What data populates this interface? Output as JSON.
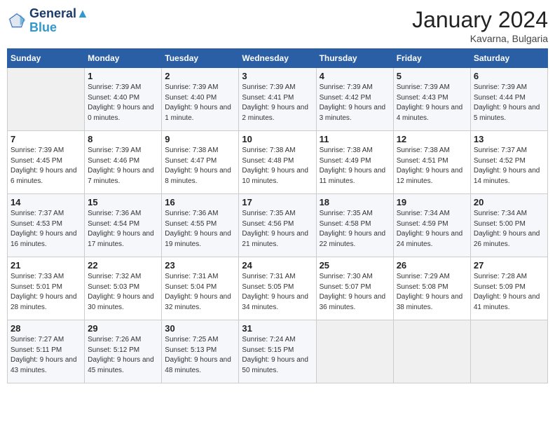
{
  "header": {
    "logo_line1": "General",
    "logo_line2": "Blue",
    "month": "January 2024",
    "location": "Kavarna, Bulgaria"
  },
  "weekdays": [
    "Sunday",
    "Monday",
    "Tuesday",
    "Wednesday",
    "Thursday",
    "Friday",
    "Saturday"
  ],
  "weeks": [
    [
      {
        "day": "",
        "sunrise": "",
        "sunset": "",
        "daylight": "",
        "empty": true
      },
      {
        "day": "1",
        "sunrise": "Sunrise: 7:39 AM",
        "sunset": "Sunset: 4:40 PM",
        "daylight": "Daylight: 9 hours and 0 minutes."
      },
      {
        "day": "2",
        "sunrise": "Sunrise: 7:39 AM",
        "sunset": "Sunset: 4:40 PM",
        "daylight": "Daylight: 9 hours and 1 minute."
      },
      {
        "day": "3",
        "sunrise": "Sunrise: 7:39 AM",
        "sunset": "Sunset: 4:41 PM",
        "daylight": "Daylight: 9 hours and 2 minutes."
      },
      {
        "day": "4",
        "sunrise": "Sunrise: 7:39 AM",
        "sunset": "Sunset: 4:42 PM",
        "daylight": "Daylight: 9 hours and 3 minutes."
      },
      {
        "day": "5",
        "sunrise": "Sunrise: 7:39 AM",
        "sunset": "Sunset: 4:43 PM",
        "daylight": "Daylight: 9 hours and 4 minutes."
      },
      {
        "day": "6",
        "sunrise": "Sunrise: 7:39 AM",
        "sunset": "Sunset: 4:44 PM",
        "daylight": "Daylight: 9 hours and 5 minutes."
      }
    ],
    [
      {
        "day": "7",
        "sunrise": "Sunrise: 7:39 AM",
        "sunset": "Sunset: 4:45 PM",
        "daylight": "Daylight: 9 hours and 6 minutes."
      },
      {
        "day": "8",
        "sunrise": "Sunrise: 7:39 AM",
        "sunset": "Sunset: 4:46 PM",
        "daylight": "Daylight: 9 hours and 7 minutes."
      },
      {
        "day": "9",
        "sunrise": "Sunrise: 7:38 AM",
        "sunset": "Sunset: 4:47 PM",
        "daylight": "Daylight: 9 hours and 8 minutes."
      },
      {
        "day": "10",
        "sunrise": "Sunrise: 7:38 AM",
        "sunset": "Sunset: 4:48 PM",
        "daylight": "Daylight: 9 hours and 10 minutes."
      },
      {
        "day": "11",
        "sunrise": "Sunrise: 7:38 AM",
        "sunset": "Sunset: 4:49 PM",
        "daylight": "Daylight: 9 hours and 11 minutes."
      },
      {
        "day": "12",
        "sunrise": "Sunrise: 7:38 AM",
        "sunset": "Sunset: 4:51 PM",
        "daylight": "Daylight: 9 hours and 12 minutes."
      },
      {
        "day": "13",
        "sunrise": "Sunrise: 7:37 AM",
        "sunset": "Sunset: 4:52 PM",
        "daylight": "Daylight: 9 hours and 14 minutes."
      }
    ],
    [
      {
        "day": "14",
        "sunrise": "Sunrise: 7:37 AM",
        "sunset": "Sunset: 4:53 PM",
        "daylight": "Daylight: 9 hours and 16 minutes."
      },
      {
        "day": "15",
        "sunrise": "Sunrise: 7:36 AM",
        "sunset": "Sunset: 4:54 PM",
        "daylight": "Daylight: 9 hours and 17 minutes."
      },
      {
        "day": "16",
        "sunrise": "Sunrise: 7:36 AM",
        "sunset": "Sunset: 4:55 PM",
        "daylight": "Daylight: 9 hours and 19 minutes."
      },
      {
        "day": "17",
        "sunrise": "Sunrise: 7:35 AM",
        "sunset": "Sunset: 4:56 PM",
        "daylight": "Daylight: 9 hours and 21 minutes."
      },
      {
        "day": "18",
        "sunrise": "Sunrise: 7:35 AM",
        "sunset": "Sunset: 4:58 PM",
        "daylight": "Daylight: 9 hours and 22 minutes."
      },
      {
        "day": "19",
        "sunrise": "Sunrise: 7:34 AM",
        "sunset": "Sunset: 4:59 PM",
        "daylight": "Daylight: 9 hours and 24 minutes."
      },
      {
        "day": "20",
        "sunrise": "Sunrise: 7:34 AM",
        "sunset": "Sunset: 5:00 PM",
        "daylight": "Daylight: 9 hours and 26 minutes."
      }
    ],
    [
      {
        "day": "21",
        "sunrise": "Sunrise: 7:33 AM",
        "sunset": "Sunset: 5:01 PM",
        "daylight": "Daylight: 9 hours and 28 minutes."
      },
      {
        "day": "22",
        "sunrise": "Sunrise: 7:32 AM",
        "sunset": "Sunset: 5:03 PM",
        "daylight": "Daylight: 9 hours and 30 minutes."
      },
      {
        "day": "23",
        "sunrise": "Sunrise: 7:31 AM",
        "sunset": "Sunset: 5:04 PM",
        "daylight": "Daylight: 9 hours and 32 minutes."
      },
      {
        "day": "24",
        "sunrise": "Sunrise: 7:31 AM",
        "sunset": "Sunset: 5:05 PM",
        "daylight": "Daylight: 9 hours and 34 minutes."
      },
      {
        "day": "25",
        "sunrise": "Sunrise: 7:30 AM",
        "sunset": "Sunset: 5:07 PM",
        "daylight": "Daylight: 9 hours and 36 minutes."
      },
      {
        "day": "26",
        "sunrise": "Sunrise: 7:29 AM",
        "sunset": "Sunset: 5:08 PM",
        "daylight": "Daylight: 9 hours and 38 minutes."
      },
      {
        "day": "27",
        "sunrise": "Sunrise: 7:28 AM",
        "sunset": "Sunset: 5:09 PM",
        "daylight": "Daylight: 9 hours and 41 minutes."
      }
    ],
    [
      {
        "day": "28",
        "sunrise": "Sunrise: 7:27 AM",
        "sunset": "Sunset: 5:11 PM",
        "daylight": "Daylight: 9 hours and 43 minutes."
      },
      {
        "day": "29",
        "sunrise": "Sunrise: 7:26 AM",
        "sunset": "Sunset: 5:12 PM",
        "daylight": "Daylight: 9 hours and 45 minutes."
      },
      {
        "day": "30",
        "sunrise": "Sunrise: 7:25 AM",
        "sunset": "Sunset: 5:13 PM",
        "daylight": "Daylight: 9 hours and 48 minutes."
      },
      {
        "day": "31",
        "sunrise": "Sunrise: 7:24 AM",
        "sunset": "Sunset: 5:15 PM",
        "daylight": "Daylight: 9 hours and 50 minutes."
      },
      {
        "day": "",
        "sunrise": "",
        "sunset": "",
        "daylight": "",
        "empty": true
      },
      {
        "day": "",
        "sunrise": "",
        "sunset": "",
        "daylight": "",
        "empty": true
      },
      {
        "day": "",
        "sunrise": "",
        "sunset": "",
        "daylight": "",
        "empty": true
      }
    ]
  ]
}
